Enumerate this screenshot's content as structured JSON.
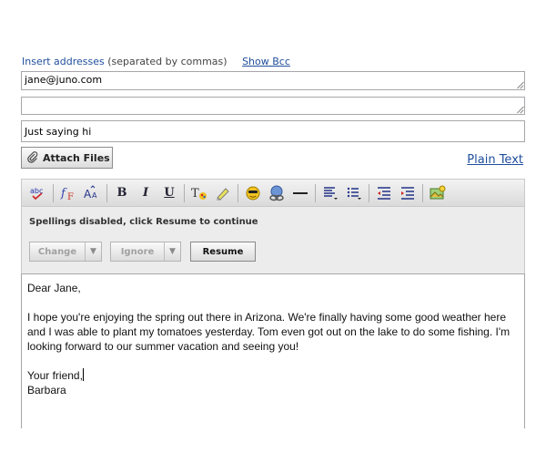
{
  "header": {
    "insert_addresses": "Insert addresses",
    "separated_note": "(separated by commas)",
    "show_bcc": "Show Bcc"
  },
  "fields": {
    "to_value": "jane@juno.com",
    "cc_value": "",
    "subject_value": "Just saying hi"
  },
  "actions": {
    "attach_files": "Attach Files",
    "plain_text": "Plain Text"
  },
  "toolbar": {
    "icons": [
      "spellcheck-icon",
      "font-icon",
      "font-size-icon",
      "bold-icon",
      "italic-icon",
      "underline-icon",
      "text-color-icon",
      "highlight-icon",
      "emoticon-icon",
      "link-icon",
      "horizontal-rule-icon",
      "align-icon",
      "list-icon",
      "outdent-icon",
      "indent-icon",
      "insert-image-icon"
    ]
  },
  "spell": {
    "message": "Spellings disabled, click Resume to continue",
    "change_label": "Change",
    "ignore_label": "Ignore",
    "resume_label": "Resume"
  },
  "body": {
    "greeting": "Dear Jane,",
    "paragraph": "I hope you're enjoying the spring out there in Arizona.  We're finally having some good weather here and I was able to plant my tomatoes yesterday.  Tom even got out on the lake to do some fishing. I'm looking forward to our summer vacation and seeing you!",
    "closing": "Your friend,",
    "signature": "Barbara"
  },
  "colors": {
    "link": "#1f4e9c",
    "toolbar_bg": "#dadada",
    "panel_bg": "#ececec"
  }
}
